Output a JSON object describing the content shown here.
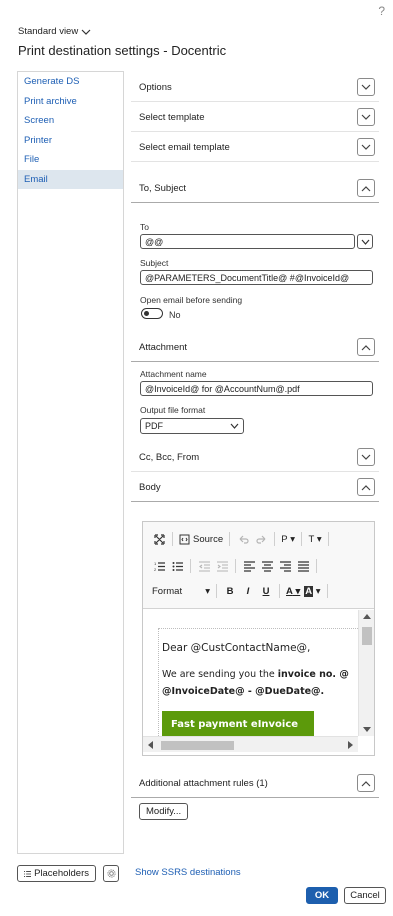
{
  "header": {
    "help_icon": "question-mark-icon",
    "view_label": "Standard view",
    "title": "Print destination settings - Docentric"
  },
  "nav": {
    "items": [
      {
        "label": "Generate DS",
        "active": false
      },
      {
        "label": "Print archive",
        "active": false
      },
      {
        "label": "Screen",
        "active": false
      },
      {
        "label": "Printer",
        "active": false
      },
      {
        "label": "File",
        "active": false
      },
      {
        "label": "Email",
        "active": true
      }
    ]
  },
  "sections": {
    "options": "Options",
    "select_template": "Select template",
    "select_email_template": "Select email template",
    "to_subject": "To, Subject",
    "attachment": "Attachment",
    "cc_bcc_from": "Cc, Bcc, From",
    "body": "Body",
    "additional_rules": "Additional attachment rules (1)"
  },
  "to_subject": {
    "to_label": "To",
    "to_value": "@@",
    "subject_label": "Subject",
    "subject_value": "@PARAMETERS_DocumentTitle@ #@InvoiceId@",
    "open_email_label": "Open email before sending",
    "open_email_value": "No"
  },
  "attachment": {
    "name_label": "Attachment name",
    "name_value": "@InvoiceId@ for @AccountNum@.pdf",
    "format_label": "Output file format",
    "format_value": "PDF"
  },
  "editor": {
    "toolbar": {
      "source": "Source",
      "paragraph": "P",
      "text": "T",
      "format": "Format",
      "bold": "B",
      "italic": "I",
      "underline": "U",
      "font_color": "A",
      "bg_color": "A"
    },
    "content": {
      "dear": "Dear @CustContactName@,",
      "sending_prefix": "We are sending you the ",
      "sending_bold": "invoice no. @",
      "dates": "@InvoiceDate@ - @DueDate@.",
      "button": "Fast payment eInvoice"
    }
  },
  "buttons": {
    "modify": "Modify...",
    "placeholders": "Placeholders",
    "show_ssrs": "Show SSRS destinations",
    "ok": "OK",
    "cancel": "Cancel"
  },
  "colors": {
    "link": "#1e5fb4",
    "primary": "#1d5fae",
    "nav_active_bg": "#dde6ee",
    "email_button": "#5c9a0b"
  }
}
